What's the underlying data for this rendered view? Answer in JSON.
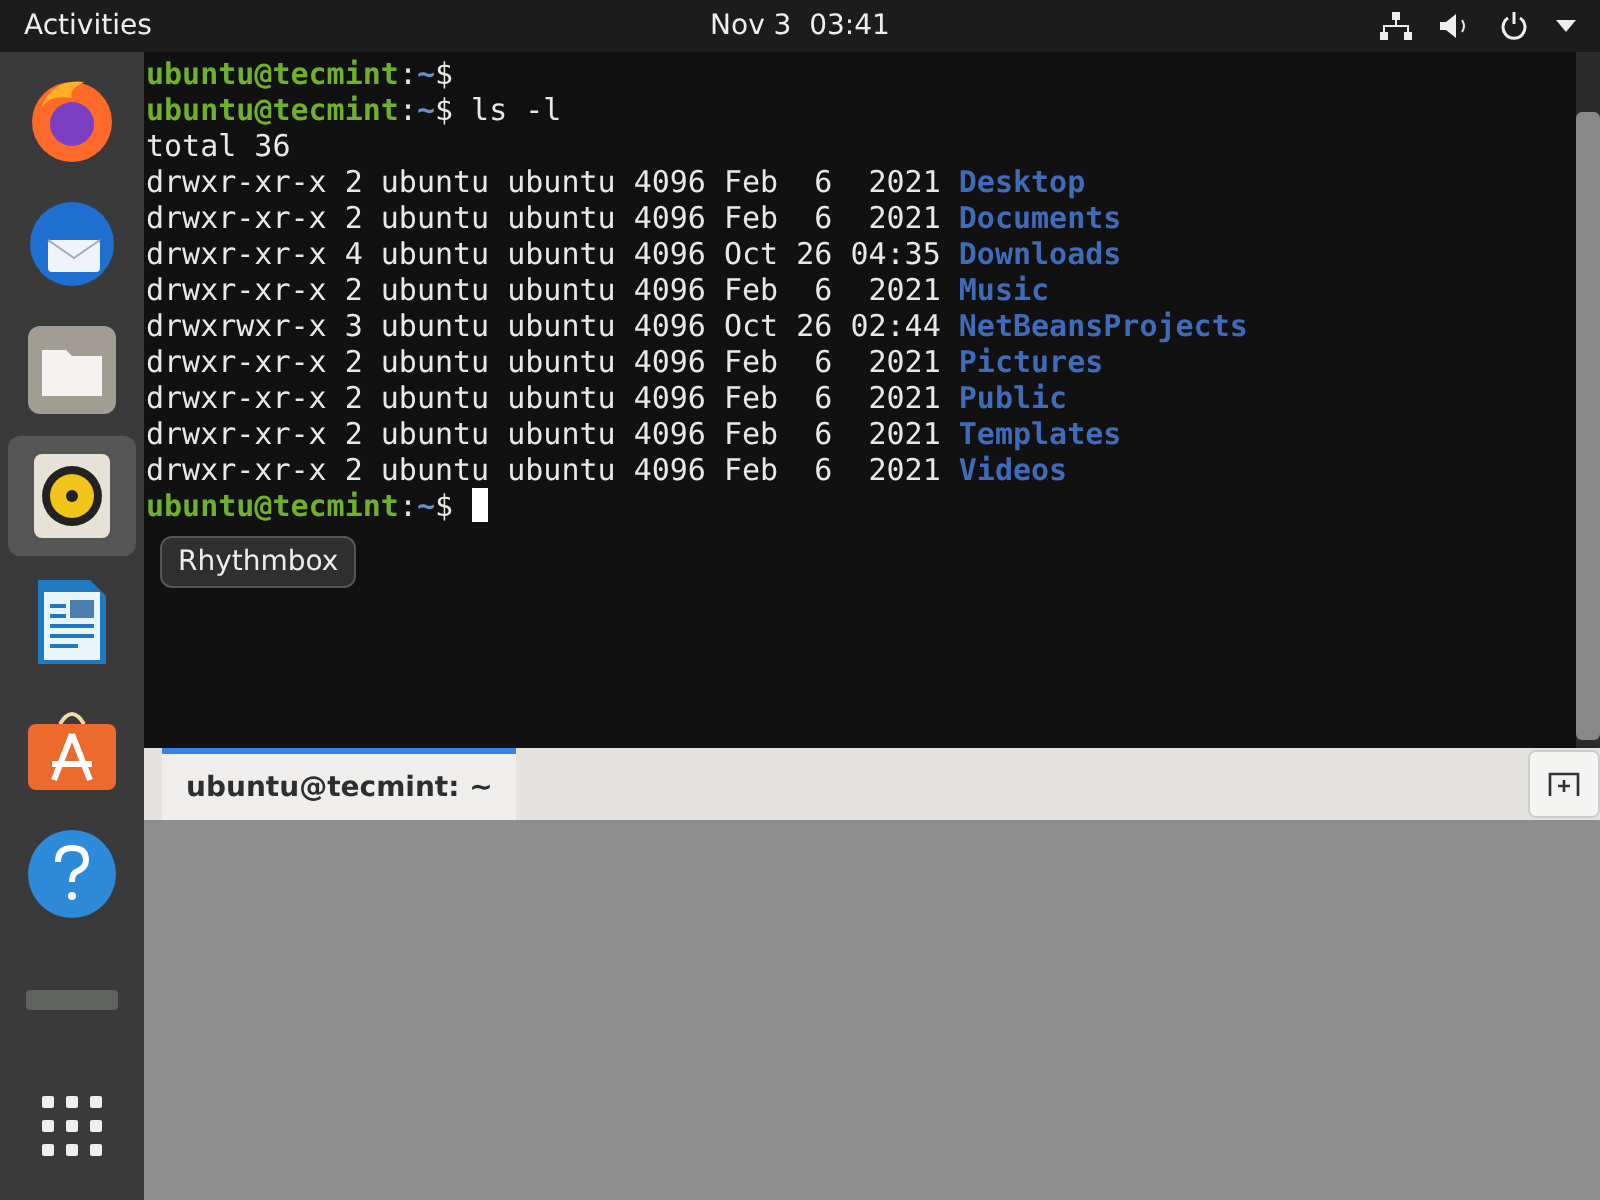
{
  "top_bar": {
    "activities": "Activities",
    "clock": "Nov 3  03:41"
  },
  "dock": {
    "items": [
      {
        "kind": "firefox",
        "selected": false
      },
      {
        "kind": "thunderbird",
        "selected": false
      },
      {
        "kind": "files",
        "selected": false
      },
      {
        "kind": "rhythmbox",
        "selected": true
      },
      {
        "kind": "writer",
        "selected": false
      },
      {
        "kind": "software",
        "selected": false
      },
      {
        "kind": "help",
        "selected": false
      },
      {
        "kind": "trash",
        "selected": false
      },
      {
        "kind": "apps",
        "selected": false
      }
    ],
    "tooltip": "Rhythmbox"
  },
  "terminal": {
    "lines": [
      {
        "kind": "prompt",
        "user": "ubuntu@tecmint",
        "separator": ":",
        "path": "~",
        "symbol": "$",
        "cursor": false
      },
      {
        "kind": "prompt",
        "user": "ubuntu@tecmint",
        "separator": ":",
        "path": "~",
        "symbol": "$",
        "command": "ls -l",
        "cursor": false
      },
      {
        "kind": "text",
        "text": "total 36"
      },
      {
        "kind": "entry",
        "meta": "drwxr-xr-x 2 ubuntu ubuntu 4096 Feb  6  2021",
        "name": "Desktop"
      },
      {
        "kind": "entry",
        "meta": "drwxr-xr-x 2 ubuntu ubuntu 4096 Feb  6  2021",
        "name": "Documents"
      },
      {
        "kind": "entry",
        "meta": "drwxr-xr-x 4 ubuntu ubuntu 4096 Oct 26 04:35",
        "name": "Downloads"
      },
      {
        "kind": "entry",
        "meta": "drwxr-xr-x 2 ubuntu ubuntu 4096 Feb  6  2021",
        "name": "Music"
      },
      {
        "kind": "entry",
        "meta": "drwxrwxr-x 3 ubuntu ubuntu 4096 Oct 26 02:44",
        "name": "NetBeansProjects"
      },
      {
        "kind": "entry",
        "meta": "drwxr-xr-x 2 ubuntu ubuntu 4096 Feb  6  2021",
        "name": "Pictures"
      },
      {
        "kind": "entry",
        "meta": "drwxr-xr-x 2 ubuntu ubuntu 4096 Feb  6  2021",
        "name": "Public"
      },
      {
        "kind": "entry",
        "meta": "drwxr-xr-x 2 ubuntu ubuntu 4096 Feb  6  2021",
        "name": "Templates"
      },
      {
        "kind": "entry",
        "meta": "drwxr-xr-x 2 ubuntu ubuntu 4096 Feb  6  2021",
        "name": "Videos"
      },
      {
        "kind": "prompt",
        "user": "ubuntu@tecmint",
        "separator": ":",
        "path": "~",
        "symbol": "$",
        "cursor": true
      }
    ],
    "tabs": [
      {
        "label": "ubuntu@tecmint: ~",
        "selected": true
      }
    ]
  }
}
